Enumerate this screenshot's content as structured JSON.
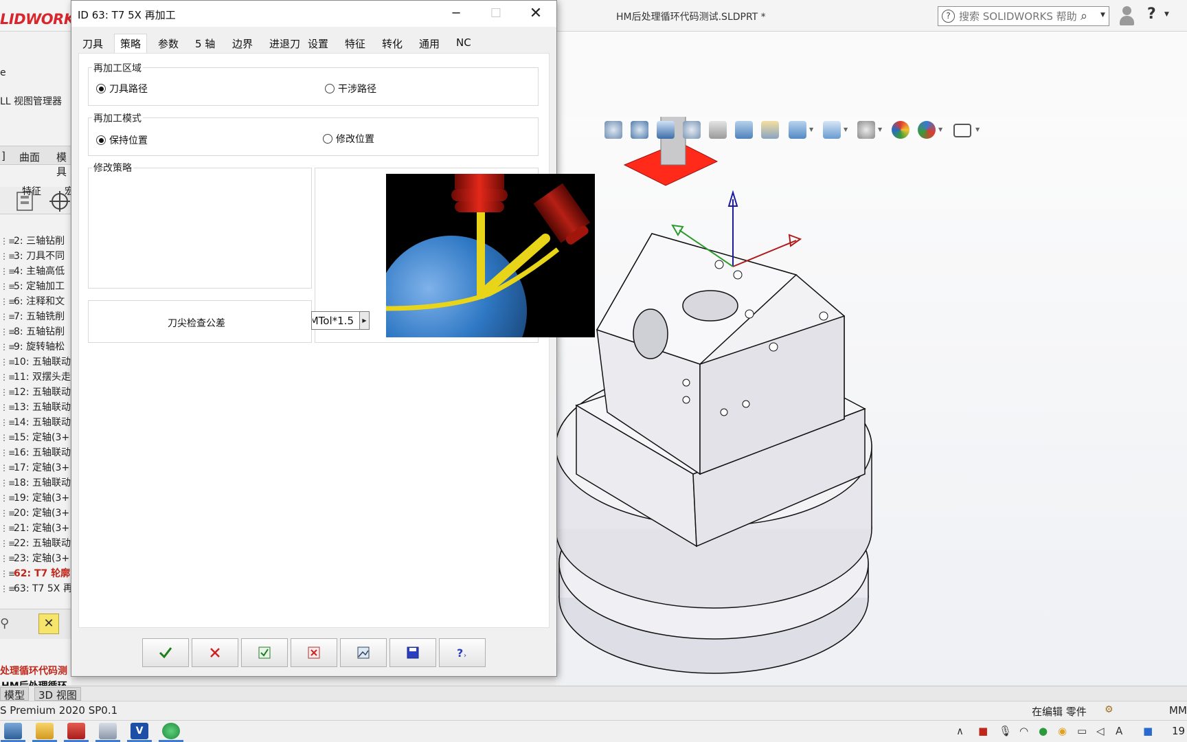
{
  "app": {
    "logo": "LIDWORKS",
    "doc_title": "HM后处理循环代码测试.SLDPRT *",
    "search_placeholder": "搜索 SOLIDWORKS 帮助"
  },
  "left_panel": {
    "line1": "e",
    "line2": "LL 视图管理器",
    "tabs": [
      "]",
      "曲面",
      "模具"
    ],
    "col_headers": [
      "特征",
      "宏"
    ],
    "tree": [
      "2: 三轴钻削",
      "3: 刀具不同",
      "4: 主轴高低",
      "5: 定轴加工",
      "6: 注释和文",
      "7: 五轴铣削",
      "8: 五轴钻削",
      "9: 旋转轴松",
      "10: 五轴联动",
      "11: 双摆头走",
      "12: 五轴联动",
      "13: 五轴联动",
      "14: 五轴联动",
      "15: 定轴(3+",
      "16: 五轴联动",
      "17: 定轴(3+",
      "18: 五轴联动",
      "19: 定轴(3+",
      "20: 定轴(3+",
      "21: 定轴(3+",
      "22: 五轴联动",
      "23: 定轴(3+",
      "62: T7 轮廓",
      "63: T7 5X 再"
    ],
    "project_name_1": "处理循环代码测",
    "project_name_2": "HM后处理循环"
  },
  "dialog": {
    "title": "ID 63: T7 5X 再加工",
    "tabs": [
      "刀具",
      "策略",
      "参数",
      "5 轴",
      "边界",
      "进退刀",
      "设置",
      "特征",
      "转化",
      "通用",
      "NC"
    ],
    "selected_tab": "策略",
    "rework_area": {
      "title": "再加工区域",
      "options": [
        "刀具路径",
        "干涉路径"
      ],
      "selected": "刀具路径"
    },
    "rework_mode": {
      "title": "再加工模式",
      "options": [
        "保持位置",
        "修改位置"
      ],
      "selected": "保持位置"
    },
    "modify_strategy": {
      "title": "修改策略"
    },
    "tip_tolerance": {
      "label": "刀尖检查公差",
      "value": "MTol*1.5"
    },
    "buttons": [
      "ok",
      "cancel",
      "apply",
      "reset",
      "preview",
      "save",
      "help"
    ]
  },
  "bottom_tabs": [
    "模型",
    "3D 视图"
  ],
  "status": {
    "left": "S Premium 2020 SP0.1",
    "edit": "在编辑 零件",
    "units": "MM"
  },
  "taskbar": {
    "clock": "19"
  },
  "colors": {
    "brand": "#d8262e",
    "active_feature": "#c0261a",
    "preview_bg": "#000000",
    "ball": "#2f78c4",
    "tool_holder": "#c8190f",
    "path_yellow": "#e8d51a"
  }
}
